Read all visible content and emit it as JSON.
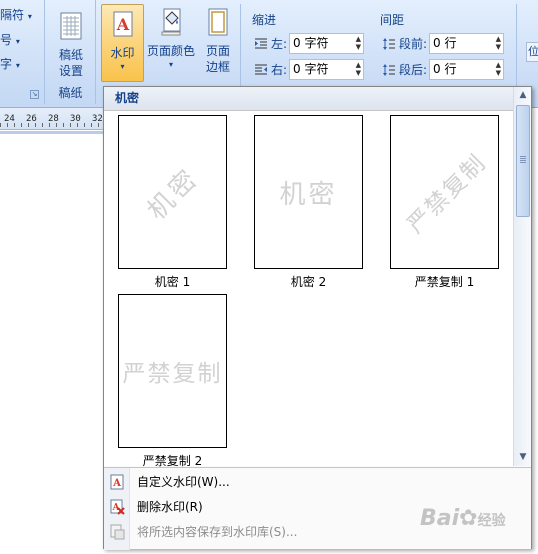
{
  "ribbon": {
    "left_group": {
      "rows": [
        "隔符",
        "号",
        "字"
      ],
      "launcher": "⌄"
    },
    "gaozhi": {
      "button_line1": "稿纸",
      "button_line2": "设置",
      "group_label": "稿纸"
    },
    "page_bg": {
      "watermark_label": "水印",
      "page_color_label": "页面颜色",
      "page_border_line1": "页面",
      "page_border_line2": "边框"
    },
    "paragraph": {
      "indent_header": "缩进",
      "spacing_header": "间距",
      "indent_left_label": "左:",
      "indent_left_value": "0 字符",
      "indent_right_label": "右:",
      "indent_right_value": "0 字符",
      "spacing_before_label": "段前:",
      "spacing_before_value": "0 行",
      "spacing_after_label": "段后:",
      "spacing_after_value": "0 行"
    },
    "right_fragment": "位"
  },
  "ruler": {
    "ticks": [
      "24",
      "26",
      "28",
      "30",
      "32"
    ]
  },
  "watermark_menu": {
    "section_header": "机密",
    "items": [
      {
        "caption": "机密 1",
        "text": "机密",
        "style": "diagonal"
      },
      {
        "caption": "机密 2",
        "text": "机密",
        "style": "horizontal"
      },
      {
        "caption": "严禁复制 1",
        "text": "严禁复制",
        "style": "diagonal"
      },
      {
        "caption": "严禁复制 2",
        "text": "严禁复制",
        "style": "horizontal"
      }
    ],
    "commands": [
      {
        "label": "自定义水印(W)...",
        "enabled": true,
        "icon": "custom-watermark-icon"
      },
      {
        "label": "删除水印(R)",
        "enabled": true,
        "icon": "remove-watermark-icon"
      },
      {
        "label": "将所选内容保存到水印库(S)...",
        "enabled": false,
        "icon": "save-to-gallery-icon"
      }
    ],
    "scroll_up": "▲",
    "scroll_down": "▼"
  },
  "baidu_watermark": {
    "logo": "Bai",
    "suffix": "经验"
  },
  "colors": {
    "ribbon_bg": "#cfe0f7",
    "active_button": "#fbd47c",
    "group_text": "#15428b",
    "watermark_gray": "#d2d2d2"
  }
}
